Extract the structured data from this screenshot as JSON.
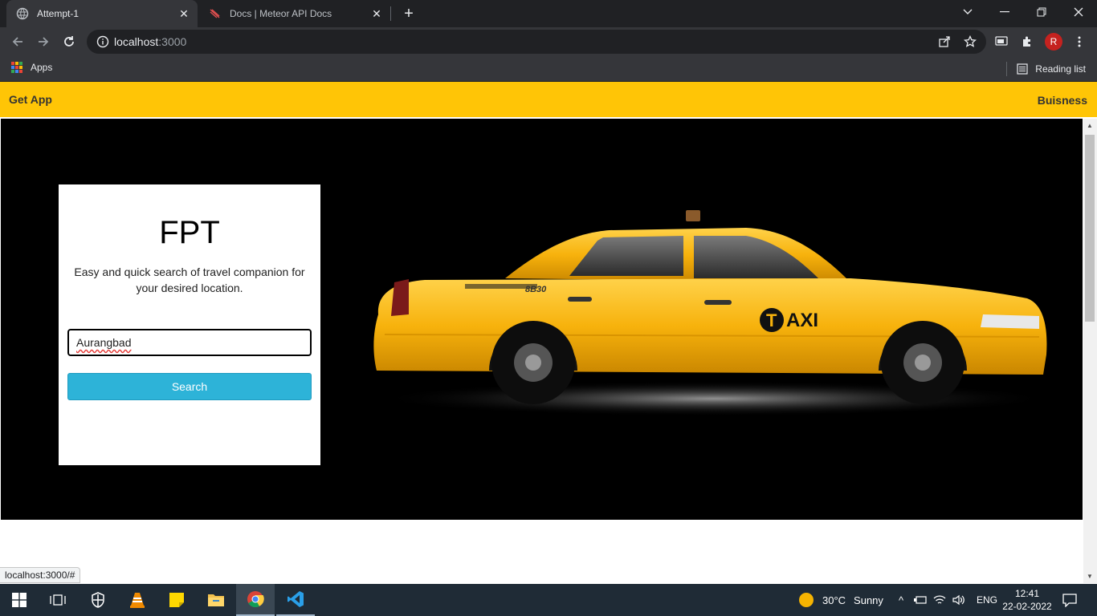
{
  "browser": {
    "tabs": [
      {
        "title": "Attempt-1",
        "active": true
      },
      {
        "title": "Docs | Meteor API Docs",
        "active": false
      }
    ],
    "url_host": "localhost",
    "url_port": ":3000",
    "profile_initial": "R",
    "bookmarks": {
      "apps_label": "Apps",
      "reading_list_label": "Reading list"
    }
  },
  "page": {
    "navbar": {
      "left_link": "Get App",
      "right_link": "Buisness"
    },
    "card": {
      "title": "FPT",
      "description": "Easy and quick search of travel companion for your desired location.",
      "search_value": "Aurangbad",
      "search_button": "Search"
    },
    "taxi_label": "TAXI",
    "taxi_number": "8B30",
    "status_tip": "localhost:3000/#"
  },
  "taskbar": {
    "weather": {
      "temp": "30°C",
      "condition": "Sunny"
    },
    "language": "ENG",
    "time": "12:41",
    "date": "22-02-2022"
  },
  "colors": {
    "navbar_bg": "#ffc506",
    "button_bg": "#2db3d8",
    "hero_bg": "#000000"
  }
}
